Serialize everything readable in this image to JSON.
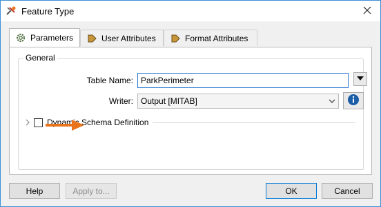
{
  "window": {
    "title": "Feature Type"
  },
  "tabs": [
    {
      "label": "Parameters",
      "icon": "gear-icon",
      "active": true
    },
    {
      "label": "User Attributes",
      "icon": "attribute-arrow-icon",
      "active": false
    },
    {
      "label": "Format Attributes",
      "icon": "attribute-arrow-icon",
      "active": false
    }
  ],
  "general": {
    "group_title": "General",
    "table_name_label": "Table Name:",
    "table_name_value": "ParkPerimeter",
    "writer_label": "Writer:",
    "writer_value": "Output [MITAB]",
    "dynamic_schema_label": "Dynamic Schema Definition",
    "dynamic_schema_checked": false
  },
  "buttons": {
    "help": "Help",
    "apply": "Apply to...",
    "ok": "OK",
    "cancel": "Cancel"
  },
  "colors": {
    "annotation_arrow": "#e8731a",
    "info_icon": "#1b5ea8",
    "focus_border": "#2b78d6"
  }
}
